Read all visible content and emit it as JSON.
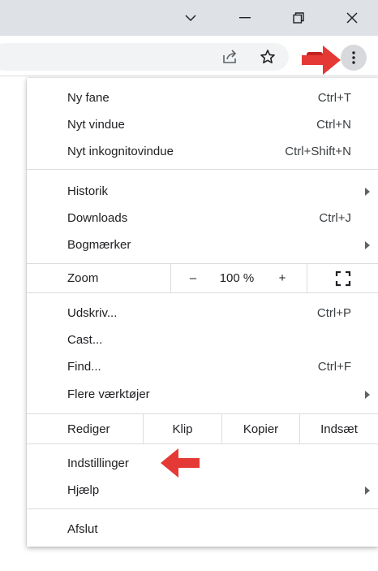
{
  "menu": {
    "section1": [
      {
        "label": "Ny fane",
        "shortcut": "Ctrl+T"
      },
      {
        "label": "Nyt vindue",
        "shortcut": "Ctrl+N"
      },
      {
        "label": "Nyt inkognitovindue",
        "shortcut": "Ctrl+Shift+N"
      }
    ],
    "section2": [
      {
        "label": "Historik",
        "shortcut": ""
      },
      {
        "label": "Downloads",
        "shortcut": "Ctrl+J"
      },
      {
        "label": "Bogmærker",
        "shortcut": ""
      }
    ],
    "zoom": {
      "label": "Zoom",
      "minus": "–",
      "value": "100 %",
      "plus": "+"
    },
    "section3": [
      {
        "label": "Udskriv...",
        "shortcut": "Ctrl+P"
      },
      {
        "label": "Cast...",
        "shortcut": ""
      },
      {
        "label": "Find...",
        "shortcut": "Ctrl+F"
      },
      {
        "label": "Flere værktøjer",
        "shortcut": ""
      }
    ],
    "edit": {
      "label": "Rediger",
      "cut": "Klip",
      "copy": "Kopier",
      "paste": "Indsæt"
    },
    "section4": [
      {
        "label": "Indstillinger"
      },
      {
        "label": "Hjælp"
      }
    ],
    "exit": {
      "label": "Afslut"
    }
  },
  "colors": {
    "annotation_arrow": "#e53935",
    "titlebar": "#dee1e6",
    "separator": "#dadce0"
  },
  "icons": [
    "chevron-down-icon",
    "minimize-icon",
    "restore-icon",
    "close-icon",
    "share-icon",
    "bookmark-star-icon",
    "menu-kebab-icon",
    "fullscreen-icon"
  ]
}
